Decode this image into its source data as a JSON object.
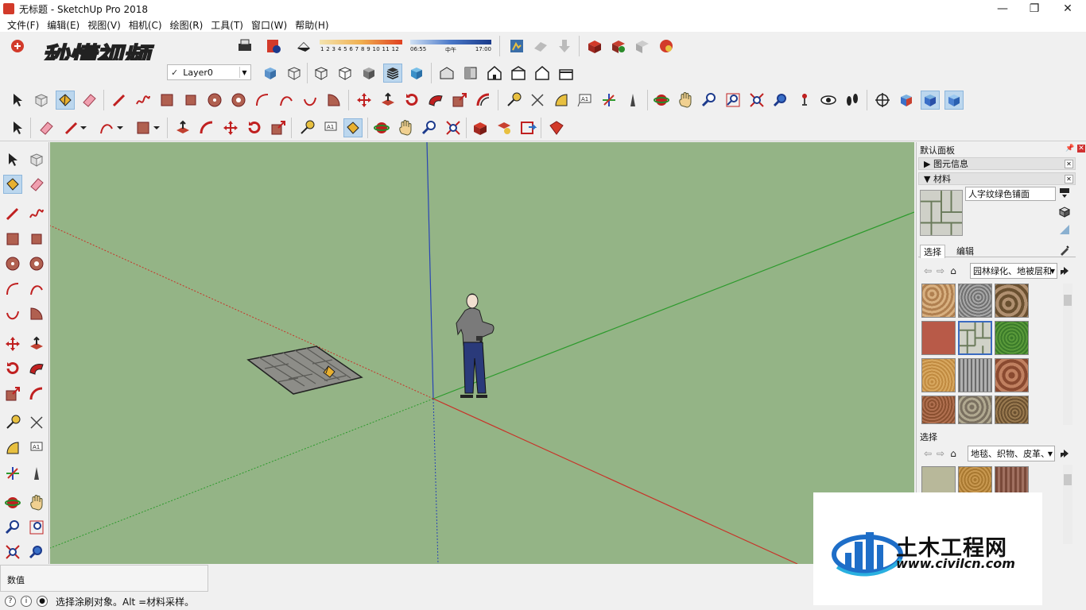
{
  "window": {
    "title": "无标题 - SketchUp Pro 2018",
    "minimize": "—",
    "maximize": "❐",
    "close": "✕"
  },
  "menu": [
    "文件(F)",
    "编辑(E)",
    "视图(V)",
    "相机(C)",
    "绘图(R)",
    "工具(T)",
    "窗口(W)",
    "帮助(H)"
  ],
  "layer": {
    "check": "✓",
    "name": "Layer0"
  },
  "shadows": {
    "month_ticks": "1 2 3 4 5 6 7 8 9 10 11 12",
    "time_start": "06:55",
    "time_mid": "中午",
    "time_end": "17:00"
  },
  "watermark_text": "秒懂视频",
  "tray": {
    "title": "默认面板",
    "entity_info": "▶ 图元信息",
    "materials": "▼ 材料",
    "material_name": "人字纹绿色铺面",
    "tab_select": "选择",
    "tab_edit": "编辑",
    "library1": "园林绿化、地被层和",
    "select2_label": "选择",
    "library2": "地毯、织物、皮革、"
  },
  "measure_label": "数值",
  "status_text": "选择涂刷对象。Alt =材料采样。",
  "civil_logo": {
    "name": "土木工程网",
    "url": "www.civilcn.com"
  },
  "colors": {
    "viewport_bg": "#94b486",
    "axis_red": "#c83228",
    "axis_green": "#2c9a2c",
    "axis_blue": "#2844b4",
    "accent": "#d23a2a"
  }
}
